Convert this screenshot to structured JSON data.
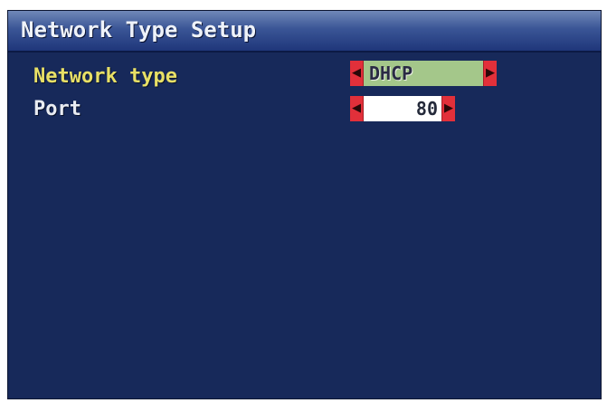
{
  "window": {
    "title": "Network Type Setup"
  },
  "settings": {
    "network_type": {
      "label": "Network type",
      "value": "DHCP"
    },
    "port": {
      "label": "Port",
      "value": "80"
    }
  },
  "icons": {
    "left_arrow": "◀",
    "right_arrow": "▶"
  },
  "colors": {
    "background": "#17295a",
    "title_bar": "#3a5596",
    "selected_label": "#e8e066",
    "label": "#e9ecf2",
    "arrow": "#e2303a",
    "selected_value_bg": "#a4c78a",
    "value_bg": "#ffffff"
  }
}
